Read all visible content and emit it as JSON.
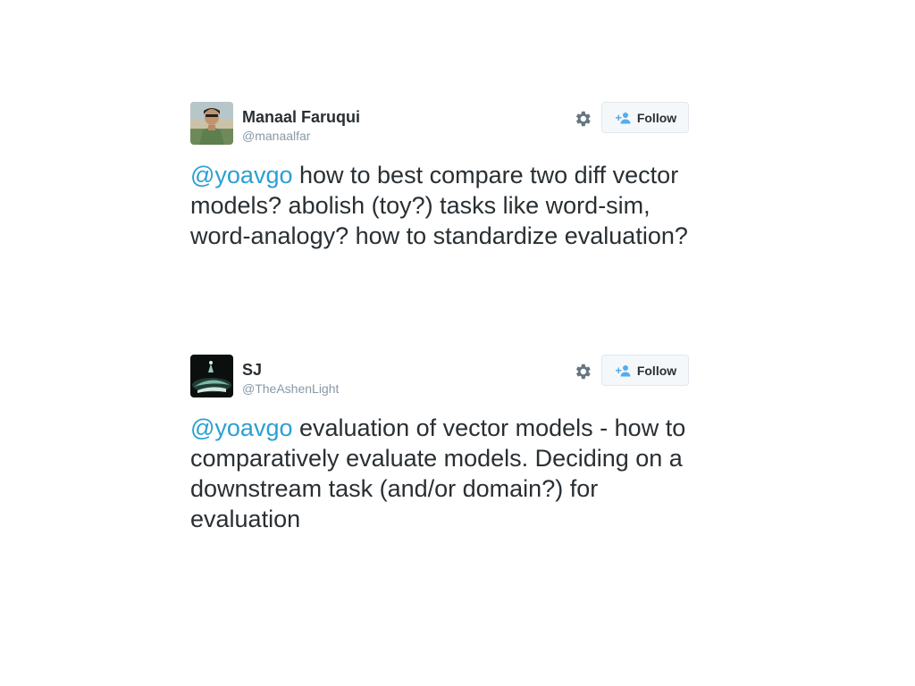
{
  "tweets": [
    {
      "user_name": "Manaal Faruqui",
      "user_handle": "@manaalfar",
      "follow_label": "Follow",
      "mention": "@yoavgo",
      "text": " how to best compare two diff vector models? abolish (toy?) tasks like word-sim, word-analogy? how to standardize evaluation?"
    },
    {
      "user_name": "SJ",
      "user_handle": "@TheAshenLight",
      "follow_label": "Follow",
      "mention": "@yoavgo",
      "text": " evaluation of vector models - how to comparatively evaluate models. Deciding on a downstream task (and/or domain?) for evaluation"
    }
  ],
  "icons": {
    "settings": "gear-icon",
    "follow": "add-user-icon"
  },
  "colors": {
    "mention": "#2b9fd3",
    "text": "#292f33",
    "handle": "#8899a6",
    "follow_bg": "#f5f8fa",
    "follow_icon": "#55acee"
  }
}
